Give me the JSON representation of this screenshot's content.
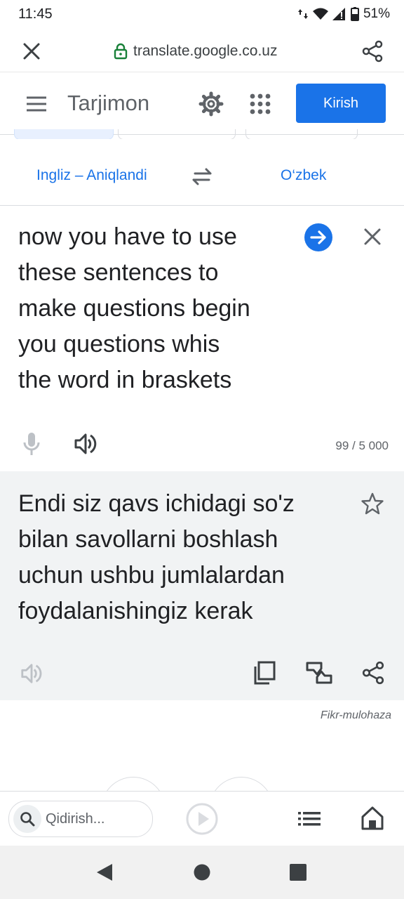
{
  "status_bar": {
    "time": "11:45",
    "battery": "51%"
  },
  "browser": {
    "url": "translate.google.co.uz"
  },
  "header": {
    "title": "Tarjimon",
    "sign_in_label": "Kirish"
  },
  "languages": {
    "source": "Ingliz – Aniqlandi",
    "target": "O‘zbek"
  },
  "source": {
    "lines": [
      "now you have to use",
      "these sentences to",
      "make questions begin",
      "you questions whis",
      "the word in braskets"
    ],
    "char_count": "99 / 5 000"
  },
  "result": {
    "lines": [
      "Endi siz qavs ichidagi so'z",
      "bilan savollarni boshlash",
      "uchun ushbu jumlalardan",
      "foydalanishingiz kerak"
    ],
    "feedback_label": "Fikr-mulohaza"
  },
  "bottom_bar": {
    "search_placeholder": "Qidirish..."
  },
  "colors": {
    "accent": "#1a73e8",
    "result_bg": "#f1f3f4",
    "nav_bg": "#f1f1f1"
  }
}
